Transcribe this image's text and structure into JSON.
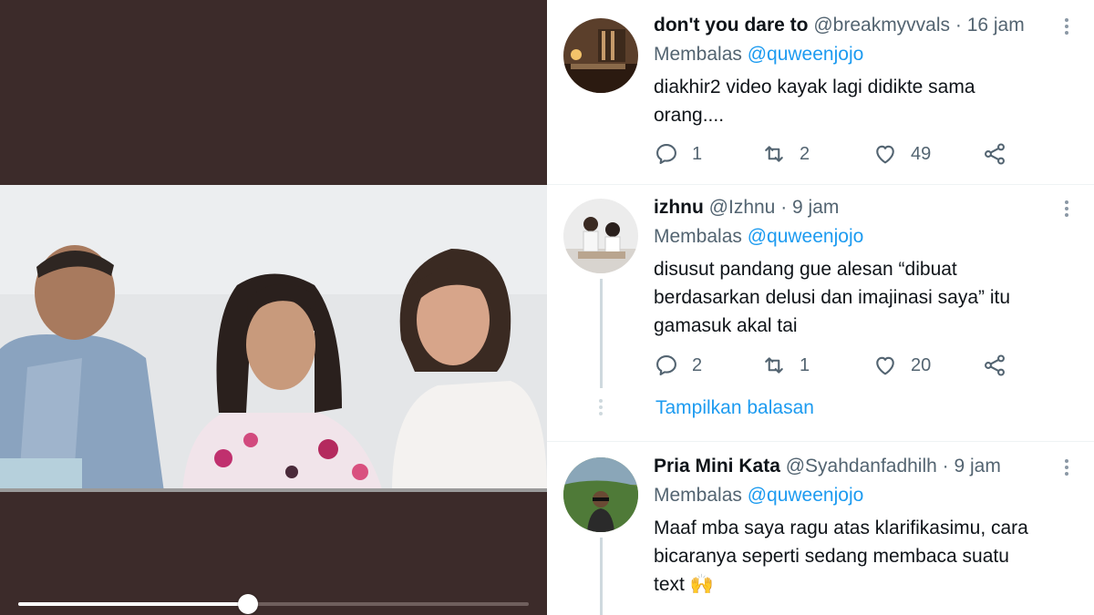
{
  "video": {
    "progress": 0.45
  },
  "tweets": [
    {
      "display_name": "don't you dare to",
      "handle": "@breakmyvvals",
      "time": "· 16 jam",
      "replying_prefix": "Membalas",
      "replying_to": "@quweenjojo",
      "text_lines": [
        "diakhir2 video kayak lagi didikte sama",
        "orang...."
      ],
      "replies": "1",
      "retweets": "2",
      "likes": "49"
    },
    {
      "display_name": "izhnu",
      "handle": "@Izhnu",
      "time": "· 9 jam",
      "replying_prefix": "Membalas",
      "replying_to": "@quweenjojo",
      "text_lines": [
        "disusut pandang gue alesan “dibuat",
        "berdasarkan delusi dan imajinasi saya” itu",
        "gamasuk akal tai"
      ],
      "replies": "2",
      "retweets": "1",
      "likes": "20"
    },
    {
      "display_name": "Pria Mini Kata",
      "handle": "@Syahdanfadhilh",
      "time": "· 9 jam",
      "replying_prefix": "Membalas",
      "replying_to": "@quweenjojo",
      "text_lines": [
        "Maaf mba saya ragu atas klarifikasimu, cara",
        "bicaranya seperti sedang membaca suatu",
        "text 🙌"
      ]
    }
  ],
  "show_replies_label": "Tampilkan balasan",
  "colors": {
    "video_bg": "#3c2b2a",
    "link": "#1d9bf0",
    "secondary_text": "#536471",
    "primary_text": "#0f1419"
  },
  "icons": [
    "reply-icon",
    "retweet-icon",
    "like-icon",
    "share-icon",
    "more-icon"
  ]
}
